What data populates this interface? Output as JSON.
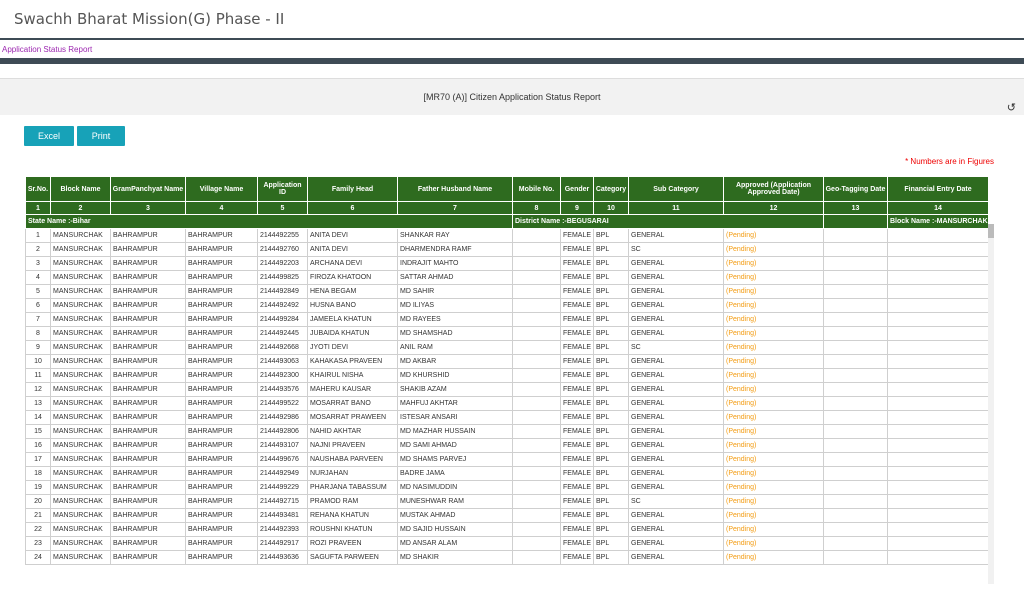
{
  "header": {
    "app_title": "Swachh Bharat Mission(G) Phase - II",
    "breadcrumb": "Application Status Report"
  },
  "report": {
    "title": "[MR70 (A)] Citizen Application Status Report",
    "refresh_icon": "↺"
  },
  "toolbar": {
    "excel_label": "Excel",
    "print_label": "Print"
  },
  "note": "* Numbers are in Figures",
  "table": {
    "columns": [
      "Sr.No.",
      "Block Name",
      "GramPanchyat Name",
      "Village Name",
      "Application ID",
      "Family Head",
      "Father Husband Name",
      "Mobile No.",
      "Gender",
      "Category",
      "Sub Category",
      "Approved (Application Approved Date)",
      "Geo-Tagging Date",
      "Financial Entry Date"
    ],
    "column_numbers": [
      "1",
      "2",
      "3",
      "4",
      "5",
      "6",
      "7",
      "8",
      "9",
      "10",
      "11",
      "12",
      "13",
      "14"
    ],
    "info": {
      "state": "State Name :-Bihar",
      "district": "District Name :-BEGUSARAI",
      "block": "Block Name :-MANSURCHAK"
    },
    "rows": [
      [
        "1",
        "MANSURCHAK",
        "BAHRAMPUR",
        "BAHRAMPUR",
        "2144492255",
        "ANITA DEVI",
        "SHANKAR RAY",
        "",
        "FEMALE",
        "BPL",
        "GENERAL",
        "(Pending)",
        "",
        ""
      ],
      [
        "2",
        "MANSURCHAK",
        "BAHRAMPUR",
        "BAHRAMPUR",
        "2144492760",
        "ANITA DEVI",
        "DHARMENDRA RAMF",
        "",
        "FEMALE",
        "BPL",
        "SC",
        "(Pending)",
        "",
        ""
      ],
      [
        "3",
        "MANSURCHAK",
        "BAHRAMPUR",
        "BAHRAMPUR",
        "2144492203",
        "ARCHANA DEVI",
        "INDRAJIT MAHTO",
        "",
        "FEMALE",
        "BPL",
        "GENERAL",
        "(Pending)",
        "",
        ""
      ],
      [
        "4",
        "MANSURCHAK",
        "BAHRAMPUR",
        "BAHRAMPUR",
        "2144499825",
        "FIROZA KHATOON",
        "SATTAR AHMAD",
        "",
        "FEMALE",
        "BPL",
        "GENERAL",
        "(Pending)",
        "",
        ""
      ],
      [
        "5",
        "MANSURCHAK",
        "BAHRAMPUR",
        "BAHRAMPUR",
        "2144492849",
        "HENA BEGAM",
        "MD SAHIR",
        "",
        "FEMALE",
        "BPL",
        "GENERAL",
        "(Pending)",
        "",
        ""
      ],
      [
        "6",
        "MANSURCHAK",
        "BAHRAMPUR",
        "BAHRAMPUR",
        "2144492492",
        "HUSNA BANO",
        "MD ILIYAS",
        "",
        "FEMALE",
        "BPL",
        "GENERAL",
        "(Pending)",
        "",
        ""
      ],
      [
        "7",
        "MANSURCHAK",
        "BAHRAMPUR",
        "BAHRAMPUR",
        "2144499284",
        "JAMEELA KHATUN",
        "MD RAYEES",
        "",
        "FEMALE",
        "BPL",
        "GENERAL",
        "(Pending)",
        "",
        ""
      ],
      [
        "8",
        "MANSURCHAK",
        "BAHRAMPUR",
        "BAHRAMPUR",
        "2144492445",
        "JUBAIDA KHATUN",
        "MD SHAMSHAD",
        "",
        "FEMALE",
        "BPL",
        "GENERAL",
        "(Pending)",
        "",
        ""
      ],
      [
        "9",
        "MANSURCHAK",
        "BAHRAMPUR",
        "BAHRAMPUR",
        "2144492668",
        "JYOTI DEVI",
        "ANIL RAM",
        "",
        "FEMALE",
        "BPL",
        "SC",
        "(Pending)",
        "",
        ""
      ],
      [
        "10",
        "MANSURCHAK",
        "BAHRAMPUR",
        "BAHRAMPUR",
        "2144493063",
        "KAHAKASA PRAVEEN",
        "MD AKBAR",
        "",
        "FEMALE",
        "BPL",
        "GENERAL",
        "(Pending)",
        "",
        ""
      ],
      [
        "11",
        "MANSURCHAK",
        "BAHRAMPUR",
        "BAHRAMPUR",
        "2144492300",
        "KHAIRUL NISHA",
        "MD KHURSHID",
        "",
        "FEMALE",
        "BPL",
        "GENERAL",
        "(Pending)",
        "",
        ""
      ],
      [
        "12",
        "MANSURCHAK",
        "BAHRAMPUR",
        "BAHRAMPUR",
        "2144493576",
        "MAHERU KAUSAR",
        "SHAKIB AZAM",
        "",
        "FEMALE",
        "BPL",
        "GENERAL",
        "(Pending)",
        "",
        ""
      ],
      [
        "13",
        "MANSURCHAK",
        "BAHRAMPUR",
        "BAHRAMPUR",
        "2144499522",
        "MOSARRAT BANO",
        "MAHFUJ AKHTAR",
        "",
        "FEMALE",
        "BPL",
        "GENERAL",
        "(Pending)",
        "",
        ""
      ],
      [
        "14",
        "MANSURCHAK",
        "BAHRAMPUR",
        "BAHRAMPUR",
        "2144492986",
        "MOSARRAT PRAWEEN",
        "ISTESAR ANSARI",
        "",
        "FEMALE",
        "BPL",
        "GENERAL",
        "(Pending)",
        "",
        ""
      ],
      [
        "15",
        "MANSURCHAK",
        "BAHRAMPUR",
        "BAHRAMPUR",
        "2144492806",
        "NAHID AKHTAR",
        "MD MAZHAR HUSSAIN",
        "",
        "FEMALE",
        "BPL",
        "GENERAL",
        "(Pending)",
        "",
        ""
      ],
      [
        "16",
        "MANSURCHAK",
        "BAHRAMPUR",
        "BAHRAMPUR",
        "2144493107",
        "NAJNI PRAVEEN",
        "MD SAMI AHMAD",
        "",
        "FEMALE",
        "BPL",
        "GENERAL",
        "(Pending)",
        "",
        ""
      ],
      [
        "17",
        "MANSURCHAK",
        "BAHRAMPUR",
        "BAHRAMPUR",
        "2144499676",
        "NAUSHABA PARVEEN",
        "MD SHAMS PARVEJ",
        "",
        "FEMALE",
        "BPL",
        "GENERAL",
        "(Pending)",
        "",
        ""
      ],
      [
        "18",
        "MANSURCHAK",
        "BAHRAMPUR",
        "BAHRAMPUR",
        "2144492949",
        "NURJAHAN",
        "BADRE JAMA",
        "",
        "FEMALE",
        "BPL",
        "GENERAL",
        "(Pending)",
        "",
        ""
      ],
      [
        "19",
        "MANSURCHAK",
        "BAHRAMPUR",
        "BAHRAMPUR",
        "2144499229",
        "PHARJANA TABASSUM",
        "MD NASIMUDDIN",
        "",
        "FEMALE",
        "BPL",
        "GENERAL",
        "(Pending)",
        "",
        ""
      ],
      [
        "20",
        "MANSURCHAK",
        "BAHRAMPUR",
        "BAHRAMPUR",
        "2144492715",
        "PRAMOD RAM",
        "MUNESHWAR RAM",
        "",
        "FEMALE",
        "BPL",
        "SC",
        "(Pending)",
        "",
        ""
      ],
      [
        "21",
        "MANSURCHAK",
        "BAHRAMPUR",
        "BAHRAMPUR",
        "2144493481",
        "REHANA KHATUN",
        "MUSTAK AHMAD",
        "",
        "FEMALE",
        "BPL",
        "GENERAL",
        "(Pending)",
        "",
        ""
      ],
      [
        "22",
        "MANSURCHAK",
        "BAHRAMPUR",
        "BAHRAMPUR",
        "2144492393",
        "ROUSHNI KHATUN",
        "MD SAJID HUSSAIN",
        "",
        "FEMALE",
        "BPL",
        "GENERAL",
        "(Pending)",
        "",
        ""
      ],
      [
        "23",
        "MANSURCHAK",
        "BAHRAMPUR",
        "BAHRAMPUR",
        "2144492917",
        "ROZI PRAVEEN",
        "MD ANSAR ALAM",
        "",
        "FEMALE",
        "BPL",
        "GENERAL",
        "(Pending)",
        "",
        ""
      ],
      [
        "24",
        "MANSURCHAK",
        "BAHRAMPUR",
        "BAHRAMPUR",
        "2144493636",
        "SAGUFTA PARWEEN",
        "MD SHAKIR",
        "",
        "FEMALE",
        "BPL",
        "GENERAL",
        "(Pending)",
        "",
        ""
      ]
    ]
  }
}
